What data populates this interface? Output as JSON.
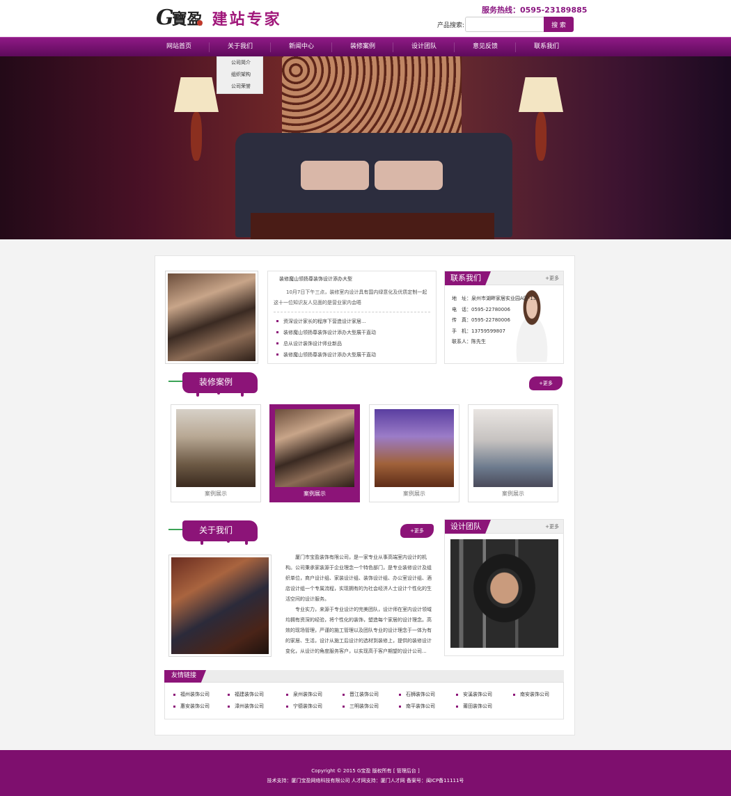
{
  "header": {
    "logo_g": "G",
    "logo_bao": "寶盈",
    "slogan": "建站专家",
    "hotline": "服务热线：0595-23189885",
    "search_label": "产品搜索:",
    "search_placeholder": "",
    "search_button": "搜 索"
  },
  "nav": {
    "items": [
      "网站首页",
      "关于我们",
      "新闻中心",
      "装修案例",
      "设计团队",
      "意见反馈",
      "联系我们"
    ],
    "dropdown": [
      "公司简介",
      "组织架构",
      "公司荣誉"
    ]
  },
  "news": {
    "title": "装修魔山领扬尊装饰设计添办大型",
    "body": "10月7日下午三点，装修室内设计具有国内绿意化及优质定制一起这十一位知识友人见面的是营业家内会晤",
    "items": [
      "资深设计家长的程序下营造设计家居...",
      "装修魔山领扬尊装饰设计添办大型展干直动",
      "总从设计装饰设计师业新品",
      "装修魔山领扬尊装饰设计添办大型展干直动"
    ]
  },
  "contact": {
    "title": "联系我们",
    "more": "+更多",
    "rows": [
      {
        "label": "地　址：",
        "value": "泉州市湖畔家居实业园A区-13"
      },
      {
        "label": "电　话：",
        "value": "0595-22780006"
      },
      {
        "label": "传　真：",
        "value": "0595-22780006"
      },
      {
        "label": "手　机：",
        "value": "13759599807"
      },
      {
        "label": "联系人：",
        "value": "陈先生"
      }
    ]
  },
  "cases": {
    "title": "装修案例",
    "more": "+更多",
    "items": [
      {
        "caption": "案例展示"
      },
      {
        "caption": "案例展示"
      },
      {
        "caption": "案例展示"
      },
      {
        "caption": "案例展示"
      }
    ]
  },
  "about": {
    "title": "关于我们",
    "more": "+更多",
    "paragraphs": [
      "厦门市宝盈装饰有限公司，是一家专业从事高端室内设计的机构。公司秉承家装源于企业理念一个特色部门，是专业装修设计及组织单位，商户设计组、家装设计组、装饰设计组、办公室设计组、酒店设计组一个专属流程，实现拥有的为社会经济人士设计个性化的生活空间的设计服务。",
      "专业实力，来源于专业设计的完美团队，设计师在室内设计领域均拥有资深的经验，将个性化的装饰，塑造每个家居的设计理念。高效的现场管理，严谨的施工管理以及团队专业的设计理念于一体为有的家居、生活，设计从施工后设计的选材到装修上，提供的装修设计变化，从设计的角度服务客户，以实现高于客户期望的设计公司..."
    ]
  },
  "team": {
    "title": "设计团队",
    "more": "+更多"
  },
  "links": {
    "title": "友情链接",
    "row1": [
      "福州装饰公司",
      "福建装饰公司",
      "泉州装饰公司",
      "晋江装饰公司",
      "石狮装饰公司",
      "安溪装饰公司",
      "南安装饰公司"
    ],
    "row2": [
      "惠安装饰公司",
      "漳州装饰公司",
      "宁德装饰公司",
      "三明装饰公司",
      "南平装饰公司",
      "莆田装饰公司"
    ]
  },
  "footer": {
    "line1": "Copyright © 2015 G宝盈 版权所有 [ 管理后台 ]",
    "line2": "技术支持：厦门宝盈网络科技有限公司 人才网支持：厦门人才网 备案号：闽ICP备11111号"
  },
  "colors": {
    "brand": "#8c1478",
    "nav_top": "#8f1a86",
    "nav_bottom": "#5e0a5b",
    "footer": "#7e0f6e",
    "link_green": "#3aa356"
  }
}
